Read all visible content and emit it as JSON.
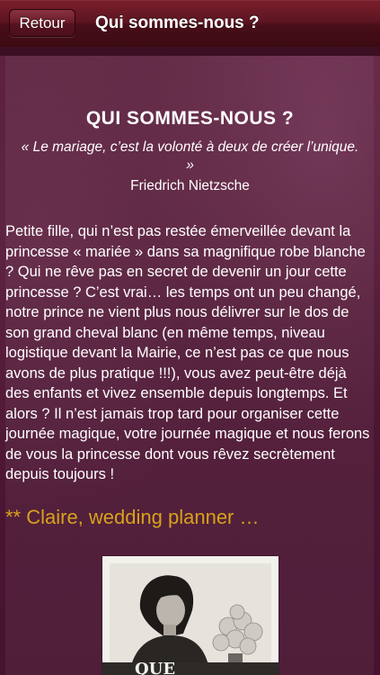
{
  "navbar": {
    "back_label": "Retour",
    "title": "Qui sommes-nous ?"
  },
  "main": {
    "heading": "QUI SOMMES-NOUS ?",
    "quote": "« Le mariage, c’est la volonté à deux de créer l’unique. »",
    "quote_author": "Friedrich Nietzsche",
    "body": "Petite fille, qui n’est pas restée émerveillée devant la princesse « mariée » dans sa magnifique robe blanche ? Qui ne rêve pas en secret de devenir un jour cette princesse ? C’est vrai… les temps ont un peu changé, notre prince ne vient plus nous délivrer sur le dos de son grand cheval blanc (en même temps, niveau logistique devant la Mairie, ce n’est pas ce que nous avons de plus pratique !!!), vous avez peut-être déjà des enfants et vivez ensemble depuis longtemps. Et alors ? Il n’est jamais trop tard pour organiser cette journée magique, votre journée magique et nous ferons de vous la princesse dont vous rêvez secrètement depuis toujours !",
    "signature": "** Claire, wedding planner …"
  },
  "colors": {
    "navbar": "#5e1522",
    "background": "#4e1733",
    "signature": "#d7a21c"
  }
}
